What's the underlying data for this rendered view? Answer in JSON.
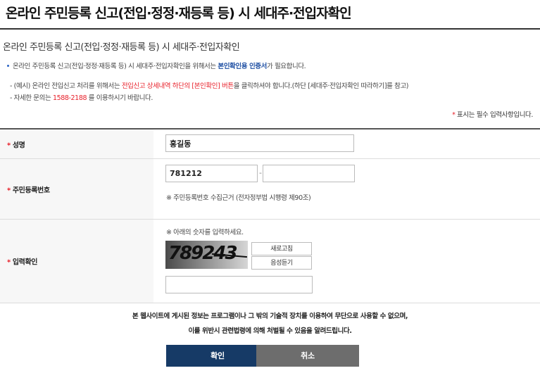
{
  "page": {
    "title": "온라인 주민등록 신고(전입·정정·재등록 등) 시 세대주·전입자확인"
  },
  "section": {
    "subtitle": "온라인 주민등록 신고(전입·정정·재등록 등) 시 세대주·전입자확인",
    "notice_line1_prefix": "온라인 주민등록 신고(전입·정정·재등록 등) 시 세대주·전입자확인을 위해서는 ",
    "notice_line1_highlight": "본인확인용 인증서",
    "notice_line1_suffix": "가 필요합니다.",
    "notice_line2_prefix": "- (예시) 온라인 전입신고 처리를 위해서는 ",
    "notice_line2_highlight": "전입신고 상세내역 하단의 [본인확인] 버튼",
    "notice_line2_suffix": "을 클릭하셔야 합니다.(하단 [세대주·전입자확인 따라하기]를 참고)",
    "notice_line3_prefix": "- 자세한 문의는 ",
    "notice_line3_phone": "1588-2188",
    "notice_line3_suffix": " 를 이용하시기 바랍니다.",
    "required_star": "*",
    "required_note": " 표시는 필수 입력사항입니다."
  },
  "form": {
    "required_star": "*",
    "name": {
      "label": "성명",
      "value": "홍길동"
    },
    "resident_number": {
      "label": "주민등록번호",
      "front_value": "781212",
      "back_value": "",
      "separator": "-",
      "note": "※ 주민등록번호 수집근거 (전자정부법 시행령 제90조)"
    },
    "captcha": {
      "label": "입력확인",
      "instruction": "※ 아래의 숫자를 입력하세요.",
      "image_text": "789243",
      "refresh_label": "새로고침",
      "audio_label": "음성듣기",
      "input_value": ""
    }
  },
  "disclaimer": {
    "line1": "본 웹사이트에 게시된 정보는 프로그램이나 그 밖의 기술적 장치를 이용하여 무단으로 사용할 수 없으며,",
    "line2": "이를 위반시 관련법령에 의해 처벌될 수 있음을 알려드립니다."
  },
  "buttons": {
    "confirm": "확인",
    "cancel": "취소"
  },
  "colors": {
    "accent_red": "#e8202a",
    "link_blue": "#1e4fa3",
    "confirm_bg": "#163a66",
    "cancel_bg": "#6d6d6d"
  }
}
